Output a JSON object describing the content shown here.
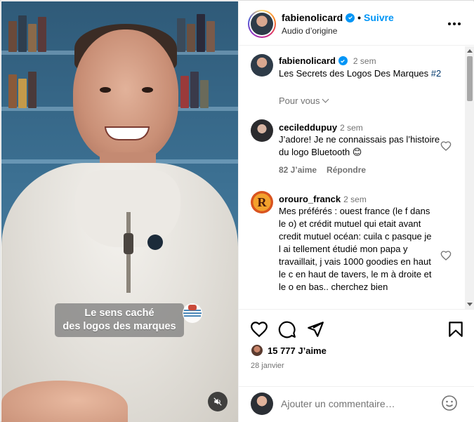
{
  "video": {
    "caption_line1": "Le sens caché",
    "caption_line2": "des logos des marques"
  },
  "header": {
    "username": "fabienolicard",
    "separator": "•",
    "follow_label": "Suivre",
    "audio_label": "Audio d’origine"
  },
  "post_caption": {
    "username": "fabienolicard",
    "time": "2 sem",
    "text": "Les Secrets des Logos Des Marques ",
    "hashtag": "#2",
    "filter_label": "Pour vous"
  },
  "comments": [
    {
      "username": "cecileddupuy",
      "time": "2 sem",
      "text": "J’adore! Je ne connaissais pas l’histoire du logo Bluetooth 😊",
      "likes": "82 J’aime",
      "reply_label": "Répondre"
    },
    {
      "username": "orouro_franck",
      "time": "2 sem",
      "text": "Mes préférés : ouest france (le f dans le o) et crédit mutuel qui etait avant credit mutuel océan: cuila c pasque je l ai tellement étudié mon papa y travaillait, j vais 1000 goodies en haut le c en haut de tavers, le m à droite et le o en bas.. cherchez bien"
    }
  ],
  "actions": {
    "likes_count": "15 777 J’aime",
    "date": "28 janvier"
  },
  "add_comment": {
    "placeholder": "Ajouter un commentaire…"
  },
  "colors": {
    "accent_blue": "#0095f6",
    "hashtag": "#00376b",
    "muted_text": "#737373"
  }
}
